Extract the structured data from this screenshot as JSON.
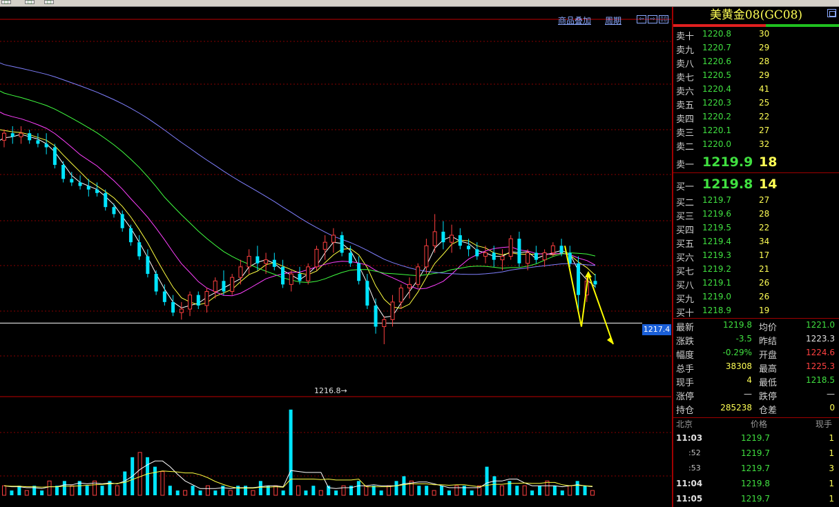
{
  "chart_links": {
    "overlay": "商品叠加",
    "period": "周期",
    "nav_left": "⇦",
    "nav_right": "⇨",
    "nav_box": "▯▯"
  },
  "chart": {
    "current_price_tag": "1217.4",
    "low_annotation": "1216.8→"
  },
  "panel": {
    "title": "美黄金08(GC08)",
    "asks": [
      {
        "label": "卖十",
        "price": "1220.8",
        "vol": "30"
      },
      {
        "label": "卖九",
        "price": "1220.7",
        "vol": "29"
      },
      {
        "label": "卖八",
        "price": "1220.6",
        "vol": "28"
      },
      {
        "label": "卖七",
        "price": "1220.5",
        "vol": "29"
      },
      {
        "label": "卖六",
        "price": "1220.4",
        "vol": "41"
      },
      {
        "label": "卖五",
        "price": "1220.3",
        "vol": "25"
      },
      {
        "label": "卖四",
        "price": "1220.2",
        "vol": "22"
      },
      {
        "label": "卖三",
        "price": "1220.1",
        "vol": "27"
      },
      {
        "label": "卖二",
        "price": "1220.0",
        "vol": "32"
      },
      {
        "label": "卖一",
        "price": "1219.9",
        "vol": "18"
      }
    ],
    "bids": [
      {
        "label": "买一",
        "price": "1219.8",
        "vol": "14"
      },
      {
        "label": "买二",
        "price": "1219.7",
        "vol": "27"
      },
      {
        "label": "买三",
        "price": "1219.6",
        "vol": "28"
      },
      {
        "label": "买四",
        "price": "1219.5",
        "vol": "22"
      },
      {
        "label": "买五",
        "price": "1219.4",
        "vol": "34"
      },
      {
        "label": "买六",
        "price": "1219.3",
        "vol": "17"
      },
      {
        "label": "买七",
        "price": "1219.2",
        "vol": "21"
      },
      {
        "label": "买八",
        "price": "1219.1",
        "vol": "26"
      },
      {
        "label": "买九",
        "price": "1219.0",
        "vol": "26"
      },
      {
        "label": "买十",
        "price": "1218.9",
        "vol": "19"
      }
    ],
    "stats": {
      "latest_label": "最新",
      "latest": "1219.8",
      "avg_label": "均价",
      "avg": "1221.0",
      "change_label": "涨跌",
      "change": "-3.5",
      "prev_close_label": "昨结",
      "prev_close": "1223.3",
      "range_label": "幅度",
      "range": "-0.29%",
      "open_label": "开盘",
      "open": "1224.6",
      "total_label": "总手",
      "total": "38308",
      "high_label": "最高",
      "high": "1225.3",
      "current_hand_label": "现手",
      "current_hand": "4",
      "low_label": "最低",
      "low": "1218.5",
      "limit_up_label": "涨停",
      "limit_up": "—",
      "limit_down_label": "跌停",
      "limit_down": "—",
      "open_interest_label": "持仓",
      "open_interest": "285238",
      "oi_diff_label": "仓差",
      "oi_diff": "0"
    },
    "ticks_header": {
      "city": "北京",
      "price": "价格",
      "qty": "现手"
    },
    "ticks": [
      {
        "time": "11:03",
        "price": "1219.7",
        "qty": "1",
        "sub": false
      },
      {
        "time": ":52",
        "price": "1219.7",
        "qty": "1",
        "sub": true
      },
      {
        "time": ":53",
        "price": "1219.7",
        "qty": "3",
        "sub": true
      },
      {
        "time": "11:04",
        "price": "1219.8",
        "qty": "1",
        "sub": false
      },
      {
        "time": "11:05",
        "price": "1219.7",
        "qty": "1",
        "sub": false
      }
    ]
  },
  "colors": {
    "up": "#ff4040",
    "down": "#00e5ff",
    "grid": "#8a0000",
    "ma1": "#ffffff",
    "ma2": "#ffff40",
    "ma3": "#ff40ff",
    "ma4": "#40ff40",
    "ma5": "#8080ff",
    "arrow": "#ffff00"
  },
  "chart_data": {
    "type": "candlestick",
    "title": "",
    "price_ylim": [
      1215.8,
      1226.0
    ],
    "candles": [
      [
        1222.6,
        1222.9,
        1222.4,
        1222.8
      ],
      [
        1222.8,
        1223.0,
        1222.5,
        1222.7
      ],
      [
        1222.7,
        1223.0,
        1222.5,
        1222.8
      ],
      [
        1222.8,
        1222.9,
        1222.5,
        1222.6
      ],
      [
        1222.6,
        1222.8,
        1222.4,
        1222.5
      ],
      [
        1222.5,
        1222.8,
        1222.2,
        1222.4
      ],
      [
        1222.4,
        1222.5,
        1221.8,
        1221.9
      ],
      [
        1221.9,
        1222.0,
        1221.4,
        1221.5
      ],
      [
        1221.5,
        1221.7,
        1221.3,
        1221.4
      ],
      [
        1221.4,
        1221.6,
        1221.2,
        1221.3
      ],
      [
        1221.3,
        1221.5,
        1221.0,
        1221.2
      ],
      [
        1221.2,
        1221.4,
        1221.0,
        1221.1
      ],
      [
        1221.1,
        1221.2,
        1220.6,
        1220.7
      ],
      [
        1220.7,
        1220.8,
        1220.4,
        1220.5
      ],
      [
        1220.5,
        1220.6,
        1220.0,
        1220.1
      ],
      [
        1220.1,
        1220.2,
        1219.6,
        1219.7
      ],
      [
        1219.7,
        1219.9,
        1219.2,
        1219.3
      ],
      [
        1219.3,
        1219.5,
        1218.7,
        1218.8
      ],
      [
        1218.8,
        1218.9,
        1218.2,
        1218.3
      ],
      [
        1218.3,
        1218.5,
        1217.9,
        1218.0
      ],
      [
        1218.0,
        1218.2,
        1217.6,
        1217.7
      ],
      [
        1217.7,
        1218.0,
        1217.5,
        1217.8
      ],
      [
        1217.8,
        1218.3,
        1217.6,
        1218.2
      ],
      [
        1218.2,
        1218.3,
        1217.8,
        1217.9
      ],
      [
        1217.9,
        1218.4,
        1217.7,
        1218.3
      ],
      [
        1218.3,
        1218.7,
        1218.1,
        1218.6
      ],
      [
        1218.6,
        1218.9,
        1218.2,
        1218.3
      ],
      [
        1218.3,
        1218.8,
        1218.2,
        1218.7
      ],
      [
        1218.7,
        1219.2,
        1218.5,
        1219.0
      ],
      [
        1219.0,
        1219.5,
        1218.8,
        1219.3
      ],
      [
        1219.3,
        1219.6,
        1218.9,
        1219.1
      ],
      [
        1219.1,
        1219.4,
        1218.8,
        1219.2
      ],
      [
        1219.2,
        1219.4,
        1218.9,
        1219.0
      ],
      [
        1219.0,
        1219.2,
        1218.4,
        1218.5
      ],
      [
        1218.5,
        1218.9,
        1218.3,
        1218.8
      ],
      [
        1218.8,
        1219.0,
        1218.5,
        1218.6
      ],
      [
        1218.6,
        1219.1,
        1218.5,
        1219.0
      ],
      [
        1219.0,
        1219.6,
        1218.9,
        1219.5
      ],
      [
        1219.5,
        1219.9,
        1219.2,
        1219.7
      ],
      [
        1219.7,
        1220.1,
        1219.4,
        1219.9
      ],
      [
        1219.9,
        1220.0,
        1219.3,
        1219.4
      ],
      [
        1219.4,
        1219.6,
        1219.0,
        1219.1
      ],
      [
        1219.1,
        1219.3,
        1218.5,
        1218.6
      ],
      [
        1218.6,
        1218.8,
        1217.8,
        1217.9
      ],
      [
        1217.9,
        1218.1,
        1217.1,
        1217.3
      ],
      [
        1217.3,
        1217.6,
        1216.8,
        1217.5
      ],
      [
        1217.5,
        1218.2,
        1217.3,
        1218.0
      ],
      [
        1218.0,
        1218.5,
        1217.8,
        1218.4
      ],
      [
        1218.4,
        1218.7,
        1218.1,
        1218.5
      ],
      [
        1218.5,
        1219.1,
        1218.4,
        1219.0
      ],
      [
        1219.0,
        1219.8,
        1218.8,
        1219.6
      ],
      [
        1219.6,
        1220.5,
        1219.4,
        1220.0
      ],
      [
        1220.0,
        1220.3,
        1219.5,
        1219.7
      ],
      [
        1219.7,
        1220.2,
        1219.4,
        1219.9
      ],
      [
        1219.9,
        1220.1,
        1219.5,
        1219.6
      ],
      [
        1219.6,
        1219.8,
        1219.3,
        1219.5
      ],
      [
        1219.5,
        1219.7,
        1219.2,
        1219.3
      ],
      [
        1219.3,
        1219.6,
        1219.1,
        1219.4
      ],
      [
        1219.4,
        1219.6,
        1219.0,
        1219.2
      ],
      [
        1219.2,
        1219.5,
        1218.9,
        1219.3
      ],
      [
        1219.3,
        1219.9,
        1219.2,
        1219.8
      ],
      [
        1219.8,
        1220.0,
        1219.0,
        1219.1
      ],
      [
        1219.1,
        1219.5,
        1218.9,
        1219.4
      ],
      [
        1219.4,
        1219.6,
        1219.1,
        1219.2
      ],
      [
        1219.2,
        1219.5,
        1219.0,
        1219.4
      ],
      [
        1219.4,
        1219.7,
        1219.3,
        1219.6
      ],
      [
        1219.6,
        1219.8,
        1219.3,
        1219.4
      ],
      [
        1219.4,
        1219.6,
        1219.0,
        1219.1
      ],
      [
        1219.1,
        1219.3,
        1217.7,
        1218.2
      ],
      [
        1218.2,
        1218.7,
        1218.0,
        1218.6
      ],
      [
        1218.6,
        1218.8,
        1218.4,
        1218.5
      ]
    ],
    "volume_ylim": [
      0,
      20
    ],
    "volumes": [
      2,
      1,
      2,
      1,
      2,
      1,
      3,
      2,
      3,
      2,
      3,
      2,
      3,
      2,
      3,
      2,
      5,
      8,
      9,
      8,
      6,
      5,
      2,
      1,
      1,
      2,
      1,
      2,
      1,
      2,
      1,
      2,
      2,
      1,
      3,
      2,
      2,
      1,
      18,
      2,
      1,
      2,
      1,
      2,
      1,
      2,
      2,
      3,
      2,
      2,
      1,
      2,
      3,
      4,
      3,
      2,
      2,
      1,
      2,
      1,
      2,
      2,
      1,
      2,
      6,
      4,
      2,
      3,
      2,
      2,
      1,
      2,
      3,
      2,
      1,
      2,
      3,
      2,
      1
    ]
  }
}
